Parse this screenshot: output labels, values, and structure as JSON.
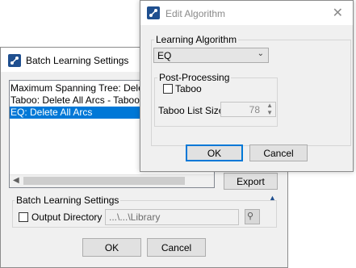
{
  "batch_window": {
    "title": "Batch Learning Settings",
    "list_items": [
      "Maximum Spanning Tree: Delete All Arcs",
      "Taboo: Delete All Arcs - Taboo List",
      "EQ: Delete All Arcs"
    ],
    "selected_index": 2,
    "export_label": "Export",
    "settings_group_label": "Batch Learning Settings",
    "output_directory_label": "Output Directory",
    "output_directory_value": "...\\...\\Library",
    "ok_label": "OK",
    "cancel_label": "Cancel"
  },
  "edit_window": {
    "title": "Edit Algorithm",
    "learning_group_label": "Learning Algorithm",
    "algorithm_value": "EQ",
    "post_processing_label": "Post-Processing",
    "taboo_label": "Taboo",
    "taboo_list_size_label": "Taboo List Size",
    "taboo_list_size_value": "78",
    "ok_label": "OK",
    "cancel_label": "Cancel"
  },
  "colors": {
    "selection": "#0078d7",
    "app_icon": "#1f4f8f"
  }
}
